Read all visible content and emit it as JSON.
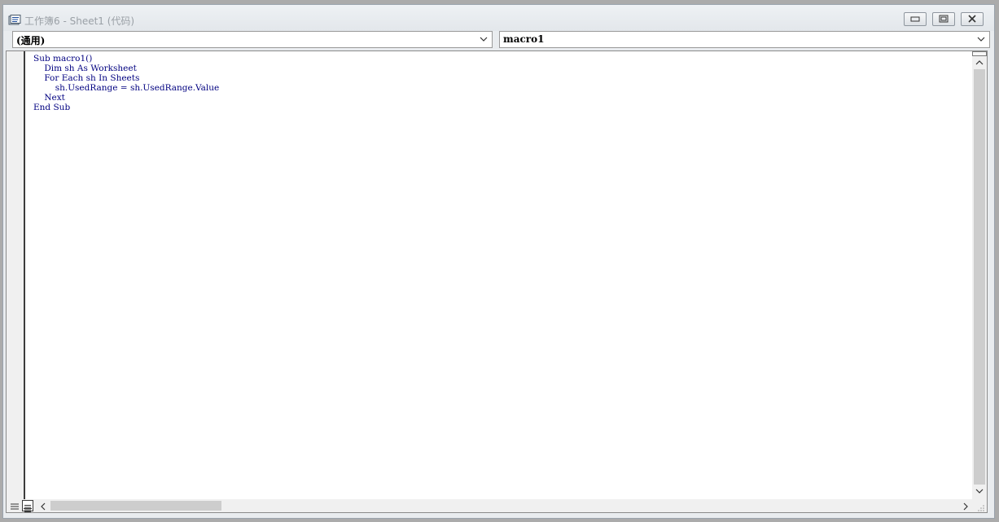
{
  "window": {
    "title": "工作簿6 - Sheet1 (代码)",
    "icons": {
      "title": "vba-module-icon",
      "minimize": "minimize-icon",
      "restore": "restore-icon",
      "close": "close-icon"
    }
  },
  "object_combo": {
    "selected": "(通用)"
  },
  "procedure_combo": {
    "selected": "macro1"
  },
  "editor": {
    "code_lines": [
      "Sub macro1()",
      "    Dim sh As Worksheet",
      "    For Each sh In Sheets",
      "        sh.UsedRange = sh.UsedRange.Value",
      "    Next",
      "End Sub"
    ]
  },
  "colors": {
    "code_text": "#000080",
    "title_text": "#9aa0a6",
    "window_bg": "#e9ecef"
  },
  "icons": {
    "procedure_view": "procedure-view-icon",
    "full_module_view": "full-module-view-icon",
    "scroll_up": "chevron-up-icon",
    "scroll_down": "chevron-down-icon",
    "scroll_left": "chevron-left-icon",
    "scroll_right": "chevron-right-icon",
    "size_grip": "size-grip-icon"
  }
}
